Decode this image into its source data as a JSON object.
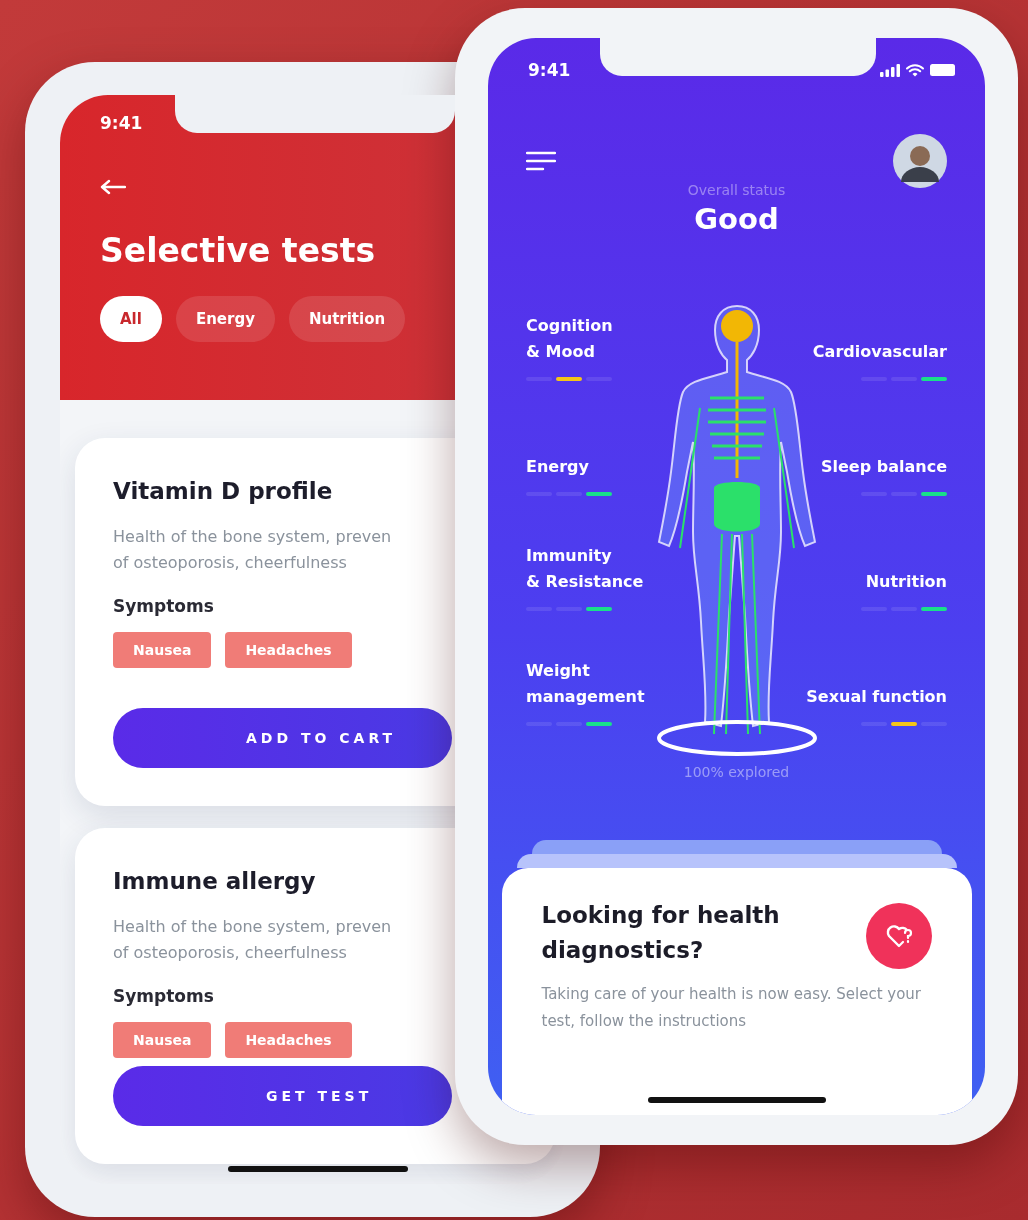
{
  "left_screen": {
    "status_time": "9:41",
    "title": "Selective tests",
    "filters": [
      {
        "label": "All",
        "selected": true
      },
      {
        "label": "Energy",
        "selected": false
      },
      {
        "label": "Nutrition",
        "selected": false
      }
    ],
    "tests": [
      {
        "title": "Vitamin D profile",
        "description": "Health of the bone system, preven\nof osteoporosis, cheerfulness",
        "symptoms_label": "Symptoms",
        "symptoms": [
          "Nausea",
          "Headaches"
        ],
        "button": "ADD TO CART"
      },
      {
        "title": "Immune allergy",
        "description": "Health of the bone system, preven\nof osteoporosis, cheerfulness",
        "symptoms_label": "Symptoms",
        "symptoms": [
          "Nausea",
          "Headaches"
        ],
        "button": "GET TEST"
      }
    ]
  },
  "right_screen": {
    "status_time": "9:41",
    "status_label": "Overall status",
    "status_value": "Good",
    "metrics": [
      {
        "label": "Cognition\n& Mood",
        "kind": "fair"
      },
      {
        "label": "Cardiovascular",
        "kind": "good"
      },
      {
        "label": "Energy",
        "kind": "good"
      },
      {
        "label": "Sleep balance",
        "kind": "good"
      },
      {
        "label": "Immunity\n& Resistance",
        "kind": "good"
      },
      {
        "label": "Nutrition",
        "kind": "good"
      },
      {
        "label": "Weight\nmanagement",
        "kind": "good"
      },
      {
        "label": "Sexual function",
        "kind": "fair"
      }
    ],
    "explored": "100% explored",
    "promo": {
      "title": "Looking for health diagnostics?",
      "text": "Taking care of your health is now easy. Select your test, follow the instructions"
    }
  }
}
